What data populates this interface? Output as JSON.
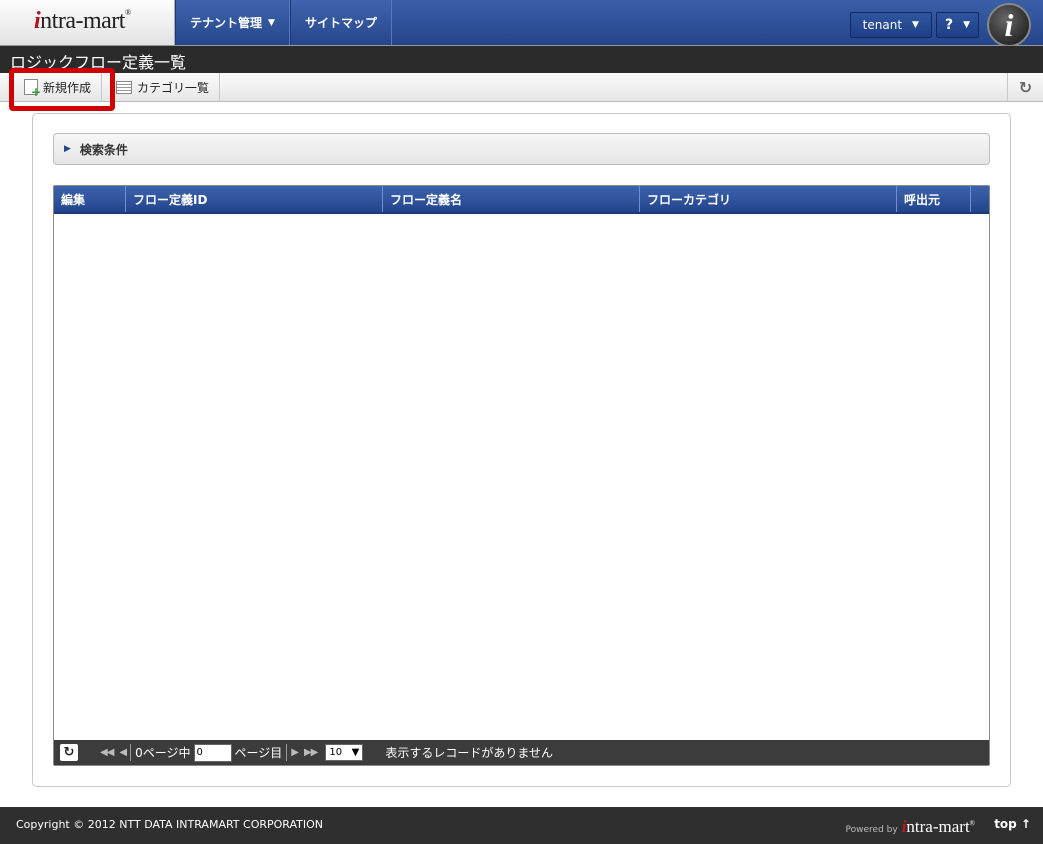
{
  "header": {
    "logo_text": "intra-mart",
    "nav": [
      {
        "label": "テナント管理",
        "has_dropdown": true
      },
      {
        "label": "サイトマップ",
        "has_dropdown": false
      }
    ],
    "user_button": "tenant",
    "help_button": "?",
    "avatar_letter": "i"
  },
  "page": {
    "title": "ロジックフロー定義一覧"
  },
  "toolbar": {
    "new_label": "新規作成",
    "category_label": "カテゴリ一覧",
    "highlight_color": "#d10000"
  },
  "search": {
    "label": "検索条件"
  },
  "table": {
    "columns": [
      "編集",
      "フロー定義ID",
      "フロー定義名",
      "フローカテゴリ",
      "呼出元"
    ],
    "rows": []
  },
  "pager": {
    "total_pages": "0",
    "page_suffix_1": "ページ中",
    "current_page": "0",
    "page_suffix_2": "ページ目",
    "page_size": "10",
    "empty_message": "表示するレコードがありません"
  },
  "footer": {
    "copyright": "Copyright © 2012 NTT DATA INTRAMART CORPORATION",
    "powered_by": "Powered by",
    "powered_logo": "intra-mart",
    "top_link": "top ↑"
  }
}
